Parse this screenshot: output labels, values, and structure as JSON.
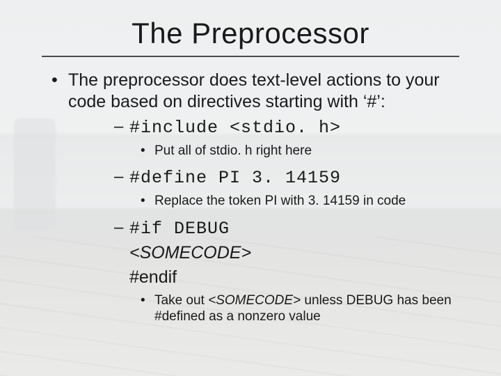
{
  "title": "The Preprocessor",
  "bullet_intro": "The preprocessor does text-level actions to your code based on directives starting with ‘#’:",
  "items": [
    {
      "code": "#include <stdio. h>",
      "note": "Put all of stdio. h right here"
    },
    {
      "code": "#define PI 3. 14159",
      "note": "Replace the token PI with 3. 14159 in code"
    },
    {
      "code": "#if DEBUG",
      "placeholder": "<SOMECODE>",
      "end": "#endif",
      "note_pre": "Take out ",
      "note_ital": "<SOMECODE>",
      "note_post": " unless DEBUG has been #defined as a nonzero value"
    }
  ]
}
